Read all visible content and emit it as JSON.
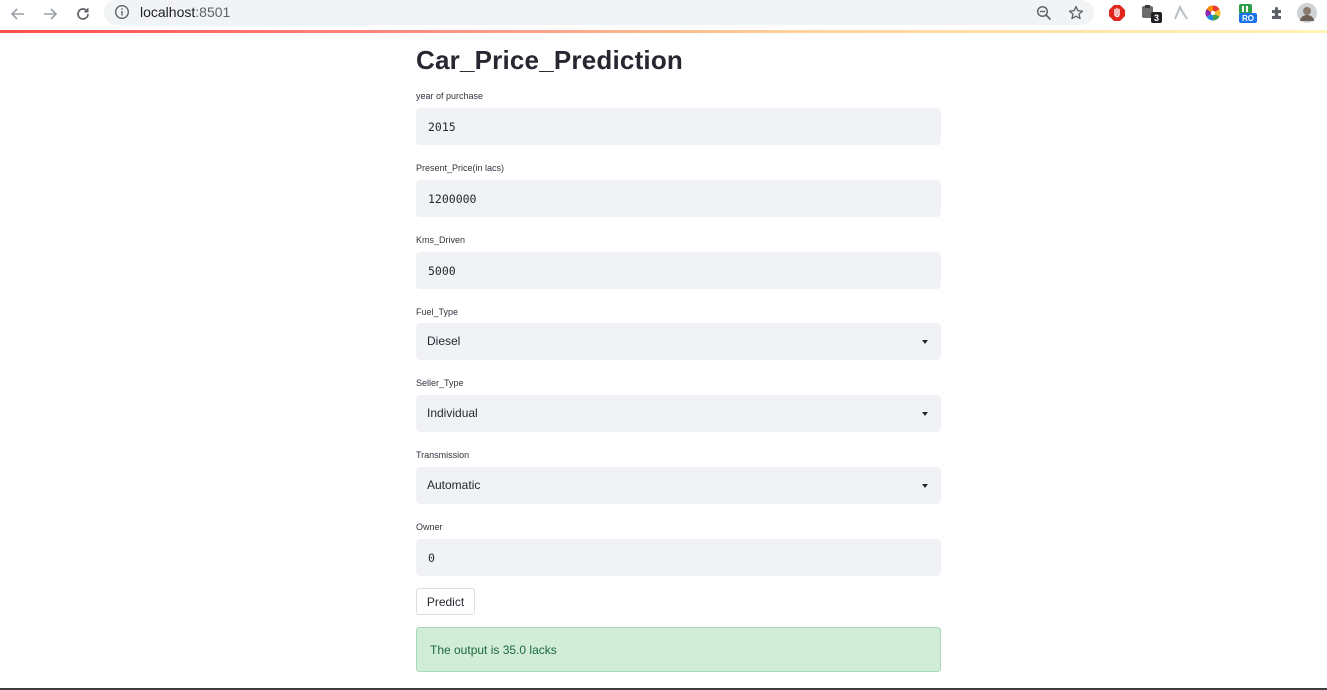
{
  "browser": {
    "url_host": "localhost",
    "url_port": ":8501",
    "extension_badge": "3",
    "extension_ro_label": "RO"
  },
  "app": {
    "title": "Car_Price_Prediction",
    "fields": {
      "year": {
        "label": "year of purchase",
        "value": "2015"
      },
      "present_price": {
        "label": "Present_Price(in lacs)",
        "value": "1200000"
      },
      "kms_driven": {
        "label": "Kms_Driven",
        "value": "5000"
      },
      "fuel_type": {
        "label": "Fuel_Type",
        "selected": "Diesel"
      },
      "seller_type": {
        "label": "Seller_Type",
        "selected": "Individual"
      },
      "transmission": {
        "label": "Transmission",
        "selected": "Automatic"
      },
      "owner": {
        "label": "Owner",
        "value": "0"
      }
    },
    "predict_label": "Predict",
    "output_message": "The output is 35.0 lacks"
  },
  "colors": {
    "accent": "#ff4b4b",
    "input_bg": "#f0f2f6",
    "success_bg": "#d1ecd9",
    "success_text": "#1c6a3a"
  }
}
